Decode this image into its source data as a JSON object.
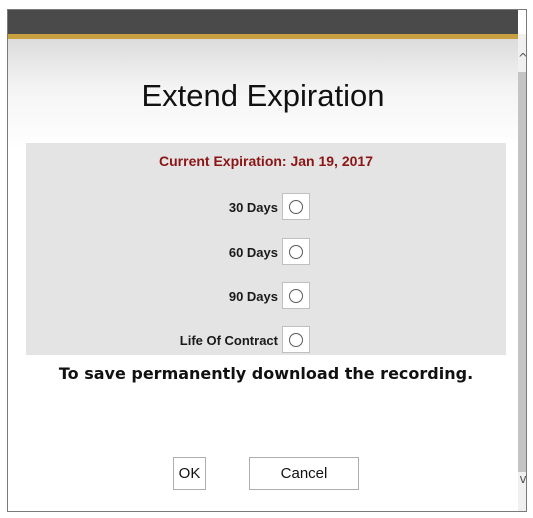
{
  "dialog": {
    "title": "Extend Expiration",
    "current_expiration": "Current Expiration: Jan 19, 2017",
    "options": [
      {
        "label": "30 Days",
        "selected": false
      },
      {
        "label": "60 Days",
        "selected": false
      },
      {
        "label": "90 Days",
        "selected": false
      },
      {
        "label": "Life Of Contract",
        "selected": false
      }
    ],
    "note": "To save permanently download the recording.",
    "buttons": {
      "ok": "OK",
      "cancel": "Cancel"
    }
  },
  "scrollbar": {
    "up_arrow": "^",
    "down_arrow": "v"
  },
  "colors": {
    "title_bar": "#4a4a4a",
    "accent": "#c8a040",
    "expiration_text": "#8b1414",
    "panel_bg": "#e4e4e4"
  }
}
